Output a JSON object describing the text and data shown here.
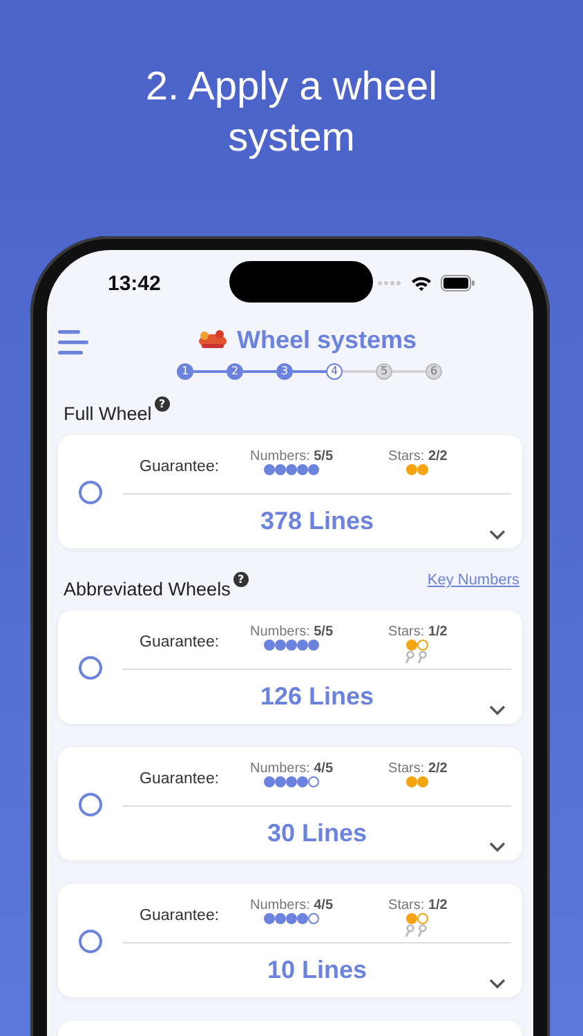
{
  "headline": "2. Apply a wheel system",
  "status_bar": {
    "time": "13:42"
  },
  "header": {
    "title": "Wheel systems"
  },
  "steps": [
    {
      "label": "1",
      "done": true,
      "selected": false
    },
    {
      "label": "2",
      "done": true,
      "selected": false
    },
    {
      "label": "3",
      "done": true,
      "selected": false
    },
    {
      "label": "4",
      "done": false,
      "selected": true
    },
    {
      "label": "5",
      "done": false,
      "selected": false
    },
    {
      "label": "6",
      "done": false,
      "selected": false
    }
  ],
  "sections": [
    {
      "title": "Full Wheel",
      "help": "?",
      "wheels": [
        {
          "kind": "full",
          "selected": false,
          "guarantee": "Guarantee:",
          "numbers": "Numbers: **5/5**",
          "number_dots": [
            true,
            true,
            true,
            true,
            true
          ],
          "stars": "Stars: **2/2**",
          "star_dots": [
            true,
            true
          ],
          "key_icons": false,
          "lines": "378 Lines"
        }
      ]
    },
    {
      "title": "Abbreviated Wheels",
      "help": "?",
      "link": "Key Numbers",
      "wheels": [
        {
          "kind": "full",
          "selected": false,
          "guarantee": "Guarantee:",
          "numbers": "Numbers: **5/5**",
          "number_dots": [
            true,
            true,
            true,
            true,
            true
          ],
          "stars": "Stars: **1/2**",
          "star_dots": [
            true,
            false
          ],
          "key_icons": true,
          "lines": "126 Lines"
        },
        {
          "kind": "full",
          "selected": false,
          "guarantee": "Guarantee:",
          "numbers": "Numbers: **4/5**",
          "number_dots": [
            true,
            true,
            true,
            true,
            false
          ],
          "stars": "Stars: **2/2**",
          "star_dots": [
            true,
            true
          ],
          "key_icons": false,
          "lines": "30 Lines"
        },
        {
          "kind": "full",
          "selected": false,
          "guarantee": "Guarantee:",
          "numbers": "Numbers: **4/5**",
          "number_dots": [
            true,
            true,
            true,
            true,
            false
          ],
          "stars": "Stars: **1/2**",
          "star_dots": [
            true,
            false
          ],
          "key_icons": true,
          "lines": "10 Lines"
        },
        {
          "kind": "cut"
        }
      ]
    }
  ]
}
